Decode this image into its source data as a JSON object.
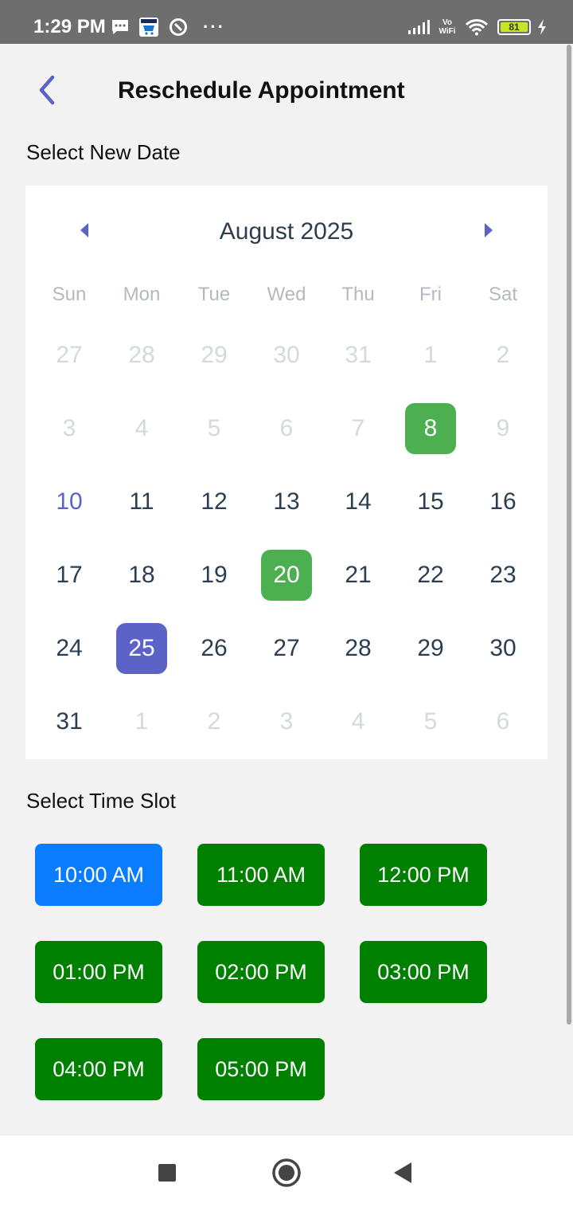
{
  "status_bar": {
    "time": "1:29 PM",
    "icons": [
      "message-icon",
      "amazon-cart-icon",
      "vpn-icon",
      "more-dots-icon",
      "signal-icon",
      "vowifi-icon",
      "wifi-icon",
      "battery-icon",
      "charging-icon"
    ],
    "overflow": "···",
    "vowifi_top": "Vo",
    "vowifi_bottom": "WiFi",
    "battery": "81"
  },
  "header": {
    "title": "Reschedule Appointment",
    "back_icon": "chevron-left-icon"
  },
  "date_section": {
    "label": "Select New Date"
  },
  "calendar": {
    "month_label": "August 2025",
    "weekdays": [
      "Sun",
      "Mon",
      "Tue",
      "Wed",
      "Thu",
      "Fri",
      "Sat"
    ],
    "days": [
      {
        "d": "27",
        "s": "muted"
      },
      {
        "d": "28",
        "s": "muted"
      },
      {
        "d": "29",
        "s": "muted"
      },
      {
        "d": "30",
        "s": "muted"
      },
      {
        "d": "31",
        "s": "muted"
      },
      {
        "d": "1",
        "s": "muted"
      },
      {
        "d": "2",
        "s": "muted"
      },
      {
        "d": "3",
        "s": "muted"
      },
      {
        "d": "4",
        "s": "muted"
      },
      {
        "d": "5",
        "s": "muted"
      },
      {
        "d": "6",
        "s": "muted"
      },
      {
        "d": "7",
        "s": "muted"
      },
      {
        "d": "8",
        "s": "marked"
      },
      {
        "d": "9",
        "s": "muted"
      },
      {
        "d": "10",
        "s": "today"
      },
      {
        "d": "11",
        "s": ""
      },
      {
        "d": "12",
        "s": ""
      },
      {
        "d": "13",
        "s": ""
      },
      {
        "d": "14",
        "s": ""
      },
      {
        "d": "15",
        "s": ""
      },
      {
        "d": "16",
        "s": ""
      },
      {
        "d": "17",
        "s": ""
      },
      {
        "d": "18",
        "s": ""
      },
      {
        "d": "19",
        "s": ""
      },
      {
        "d": "20",
        "s": "marked"
      },
      {
        "d": "21",
        "s": ""
      },
      {
        "d": "22",
        "s": ""
      },
      {
        "d": "23",
        "s": ""
      },
      {
        "d": "24",
        "s": ""
      },
      {
        "d": "25",
        "s": "selected"
      },
      {
        "d": "26",
        "s": ""
      },
      {
        "d": "27",
        "s": ""
      },
      {
        "d": "28",
        "s": ""
      },
      {
        "d": "29",
        "s": ""
      },
      {
        "d": "30",
        "s": ""
      },
      {
        "d": "31",
        "s": ""
      },
      {
        "d": "1",
        "s": "muted"
      },
      {
        "d": "2",
        "s": "muted"
      },
      {
        "d": "3",
        "s": "muted"
      },
      {
        "d": "4",
        "s": "muted"
      },
      {
        "d": "5",
        "s": "muted"
      },
      {
        "d": "6",
        "s": "muted"
      }
    ]
  },
  "time_section": {
    "label": "Select Time Slot",
    "slots": [
      "10:00 AM",
      "11:00 AM",
      "12:00 PM",
      "01:00 PM",
      "02:00 PM",
      "03:00 PM",
      "04:00 PM",
      "05:00 PM"
    ],
    "active_slot": "10:00 AM"
  },
  "colors": {
    "accent": "#5b63c6",
    "marked_day": "#4caf50",
    "slot_green": "#008000",
    "slot_active": "#0a7cff"
  },
  "nav_bar": {
    "icons": [
      "recents-square-icon",
      "home-circle-icon",
      "back-triangle-icon"
    ]
  }
}
